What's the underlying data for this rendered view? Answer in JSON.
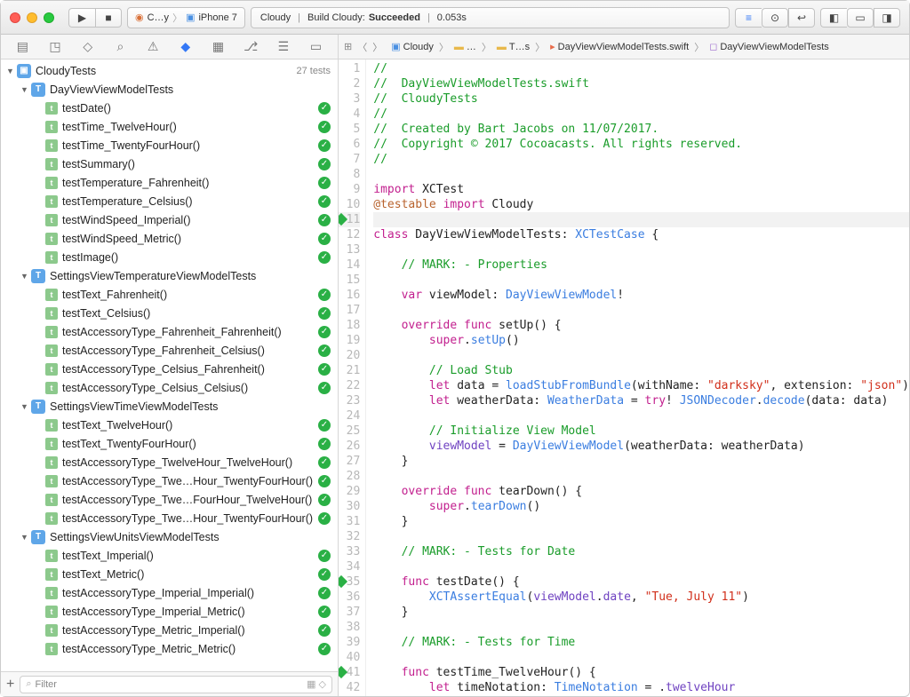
{
  "toolbar": {
    "scheme_left": "C…y",
    "scheme_right": "iPhone 7",
    "status_app": "Cloudy",
    "status_action": "Build Cloudy:",
    "status_result": "Succeeded",
    "status_time": "0.053s"
  },
  "filter": {
    "placeholder": "Filter"
  },
  "tree": {
    "root": {
      "label": "CloudyTests",
      "meta": "27 tests"
    },
    "groups": [
      {
        "label": "DayViewViewModelTests",
        "tests": [
          "testDate()",
          "testTime_TwelveHour()",
          "testTime_TwentyFourHour()",
          "testSummary()",
          "testTemperature_Fahrenheit()",
          "testTemperature_Celsius()",
          "testWindSpeed_Imperial()",
          "testWindSpeed_Metric()",
          "testImage()"
        ]
      },
      {
        "label": "SettingsViewTemperatureViewModelTests",
        "tests": [
          "testText_Fahrenheit()",
          "testText_Celsius()",
          "testAccessoryType_Fahrenheit_Fahrenheit()",
          "testAccessoryType_Fahrenheit_Celsius()",
          "testAccessoryType_Celsius_Fahrenheit()",
          "testAccessoryType_Celsius_Celsius()"
        ]
      },
      {
        "label": "SettingsViewTimeViewModelTests",
        "tests": [
          "testText_TwelveHour()",
          "testText_TwentyFourHour()",
          "testAccessoryType_TwelveHour_TwelveHour()",
          "testAccessoryType_Twe…Hour_TwentyFourHour()",
          "testAccessoryType_Twe…FourHour_TwelveHour()",
          "testAccessoryType_Twe…Hour_TwentyFourHour()"
        ]
      },
      {
        "label": "SettingsViewUnitsViewModelTests",
        "tests": [
          "testText_Imperial()",
          "testText_Metric()",
          "testAccessoryType_Imperial_Imperial()",
          "testAccessoryType_Imperial_Metric()",
          "testAccessoryType_Metric_Imperial()",
          "testAccessoryType_Metric_Metric()"
        ]
      }
    ]
  },
  "breadcrumb": {
    "items": [
      "Cloudy",
      "…",
      "T…s",
      "DayViewViewModelTests.swift",
      "DayViewViewModelTests"
    ]
  },
  "code": {
    "lines": [
      {
        "n": 1,
        "t": "comment",
        "text": "//"
      },
      {
        "n": 2,
        "t": "comment",
        "text": "//  DayViewViewModelTests.swift"
      },
      {
        "n": 3,
        "t": "comment",
        "text": "//  CloudyTests"
      },
      {
        "n": 4,
        "t": "comment",
        "text": "//"
      },
      {
        "n": 5,
        "t": "comment",
        "text": "//  Created by Bart Jacobs on 11/07/2017."
      },
      {
        "n": 6,
        "t": "comment",
        "text": "//  Copyright © 2017 Cocoacasts. All rights reserved."
      },
      {
        "n": 7,
        "t": "comment",
        "text": "//"
      },
      {
        "n": 8,
        "t": "blank",
        "text": ""
      },
      {
        "n": 9,
        "t": "import1"
      },
      {
        "n": 10,
        "t": "import2"
      },
      {
        "n": 11,
        "t": "blank",
        "text": "",
        "hl": true,
        "diamond": true
      },
      {
        "n": 12,
        "t": "class"
      },
      {
        "n": 13,
        "t": "blank",
        "text": ""
      },
      {
        "n": 14,
        "t": "comment",
        "text": "    // MARK: - Properties"
      },
      {
        "n": 15,
        "t": "blank",
        "text": ""
      },
      {
        "n": 16,
        "t": "var"
      },
      {
        "n": 17,
        "t": "blank",
        "text": ""
      },
      {
        "n": 18,
        "t": "setup1"
      },
      {
        "n": 19,
        "t": "setup2"
      },
      {
        "n": 20,
        "t": "blank",
        "text": ""
      },
      {
        "n": 21,
        "t": "comment",
        "text": "        // Load Stub"
      },
      {
        "n": 22,
        "t": "load"
      },
      {
        "n": 23,
        "t": "weather"
      },
      {
        "n": 24,
        "t": "blank",
        "text": ""
      },
      {
        "n": 25,
        "t": "comment",
        "text": "        // Initialize View Model"
      },
      {
        "n": 26,
        "t": "vm"
      },
      {
        "n": 27,
        "t": "plain",
        "text": "    }"
      },
      {
        "n": 28,
        "t": "blank",
        "text": ""
      },
      {
        "n": 29,
        "t": "teardown1"
      },
      {
        "n": 30,
        "t": "teardown2"
      },
      {
        "n": 31,
        "t": "plain",
        "text": "    }"
      },
      {
        "n": 32,
        "t": "blank",
        "text": ""
      },
      {
        "n": 33,
        "t": "comment",
        "text": "    // MARK: - Tests for Date"
      },
      {
        "n": 34,
        "t": "blank",
        "text": ""
      },
      {
        "n": 35,
        "t": "testdate1",
        "diamond": true
      },
      {
        "n": 36,
        "t": "testdate2"
      },
      {
        "n": 37,
        "t": "plain",
        "text": "    }"
      },
      {
        "n": 38,
        "t": "blank",
        "text": ""
      },
      {
        "n": 39,
        "t": "comment",
        "text": "    // MARK: - Tests for Time"
      },
      {
        "n": 40,
        "t": "blank",
        "text": ""
      },
      {
        "n": 41,
        "t": "testtime1",
        "diamond": true
      },
      {
        "n": 42,
        "t": "testtime2"
      }
    ]
  }
}
